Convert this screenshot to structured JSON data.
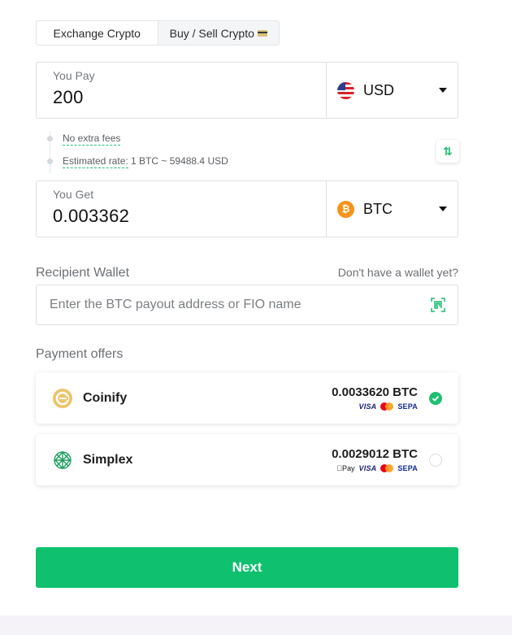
{
  "tabs": [
    {
      "label": "Exchange Crypto",
      "active": true
    },
    {
      "label": "Buy / Sell Crypto",
      "active": false
    }
  ],
  "pay": {
    "label": "You Pay",
    "value": "200",
    "currency": "USD",
    "currency_icon": "us-flag-icon"
  },
  "info": {
    "fees": "No extra fees",
    "rate_label": "Estimated rate:",
    "rate_value": "1 BTC ~ 59488.4 USD"
  },
  "get": {
    "label": "You Get",
    "value": "0.003362",
    "currency": "BTC",
    "currency_icon": "bitcoin-icon",
    "currency_symbol": "₿"
  },
  "wallet": {
    "title": "Recipient Wallet",
    "help_link": "Don't have a wallet yet?",
    "placeholder": "Enter the BTC payout address or FIO name"
  },
  "offers": {
    "title": "Payment offers",
    "items": [
      {
        "name": "Coinify",
        "amount": "0.0033620 BTC",
        "methods": [
          "VISA",
          "mastercard",
          "SEPA"
        ],
        "selected": true
      },
      {
        "name": "Simplex",
        "amount": "0.0029012 BTC",
        "methods": [
          "Apple Pay",
          "VISA",
          "mastercard",
          "SEPA"
        ],
        "selected": false
      }
    ],
    "apple_pay_label": "Pay",
    "visa_label": "VISA",
    "sepa_label": "SEPA"
  },
  "next_label": "Next",
  "colors": {
    "accent": "#0fc06f",
    "check": "#1fbf73"
  }
}
